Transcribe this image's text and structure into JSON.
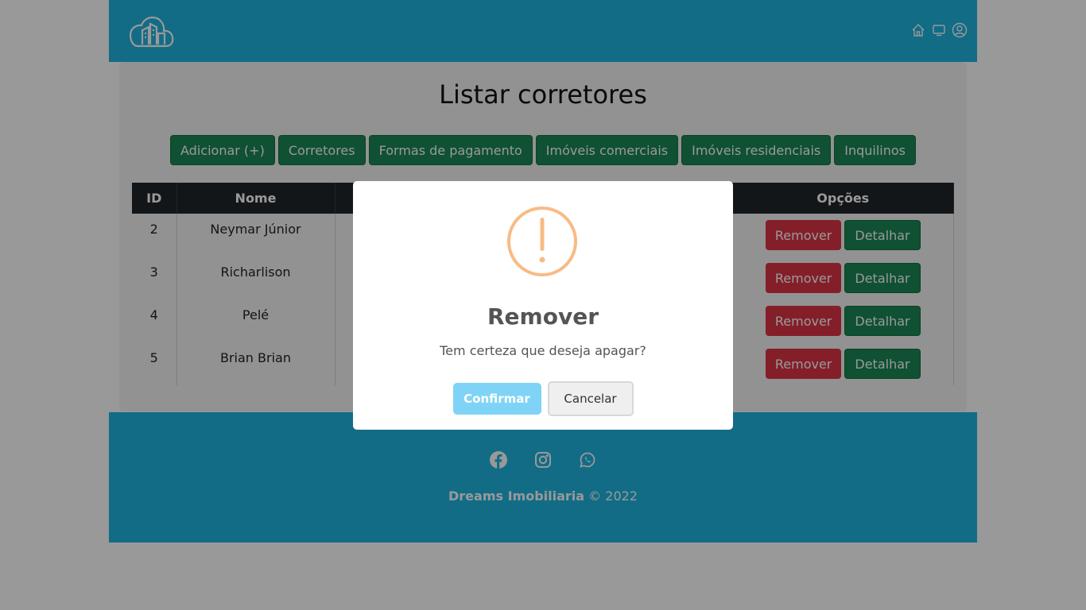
{
  "colors": {
    "header_bg": "#1fb4e0",
    "green": "#198754",
    "red": "#dc3545",
    "table_head": "#212529",
    "warn": "#f8bb86",
    "confirm": "#7fd3f7"
  },
  "header": {
    "logo_icon": "cloud-buildings-logo",
    "icons": [
      "home-icon",
      "monitor-icon",
      "user-circle-icon"
    ]
  },
  "main": {
    "title": "Listar corretores",
    "nav_buttons": [
      "Adicionar (+)",
      "Corretores",
      "Formas de pagamento",
      "Imóveis comerciais",
      "Imóveis residenciais",
      "Inquilinos"
    ],
    "table": {
      "headers": [
        "ID",
        "Nome",
        "Opções"
      ],
      "rows": [
        {
          "id": "2",
          "name": "Neymar Júnior"
        },
        {
          "id": "3",
          "name": "Richarlison"
        },
        {
          "id": "4",
          "name": "Pelé"
        },
        {
          "id": "5",
          "name": "Brian Brian"
        }
      ],
      "remove_label": "Remover",
      "detail_label": "Detalhar"
    }
  },
  "footer": {
    "social_icons": [
      "facebook-icon",
      "instagram-icon",
      "whatsapp-icon"
    ],
    "brand": "Dreams Imobiliaria",
    "copyright": "© 2022"
  },
  "modal": {
    "icon": "warning-icon",
    "title": "Remover",
    "text": "Tem certeza que deseja apagar?",
    "confirm_label": "Confirmar",
    "cancel_label": "Cancelar"
  }
}
